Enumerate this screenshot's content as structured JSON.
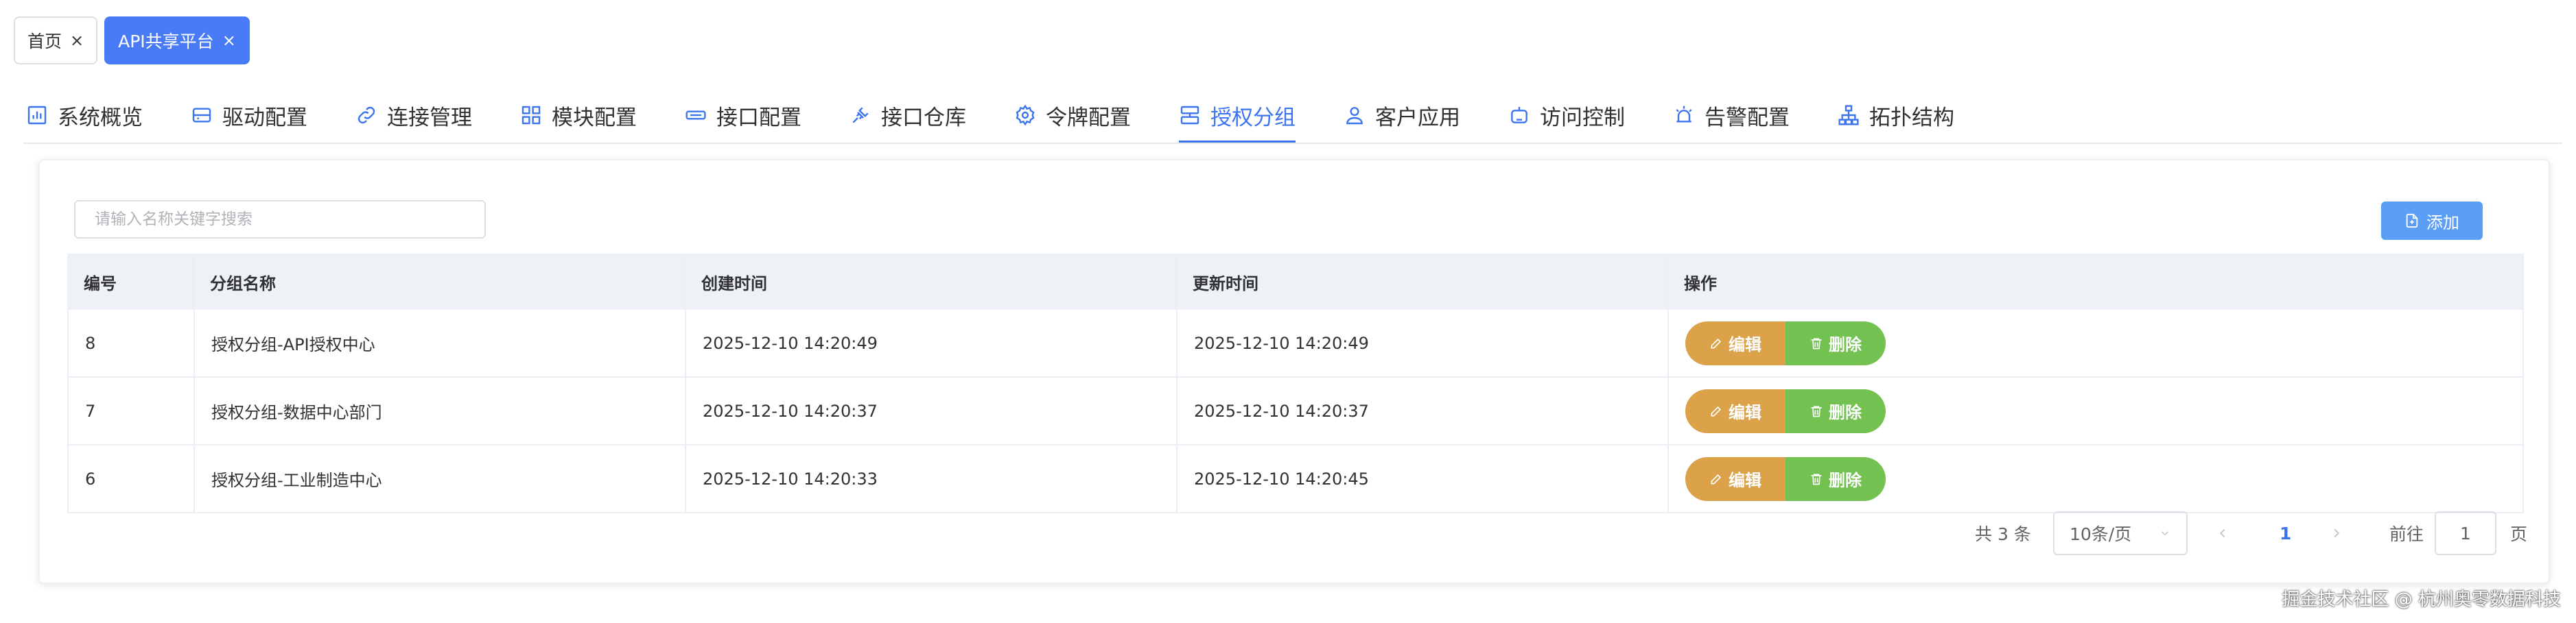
{
  "page_tabs": [
    {
      "label": "首页",
      "close": "×"
    },
    {
      "label": "API共享平台",
      "close": "×"
    }
  ],
  "nav": [
    {
      "label": "系统概览",
      "icon": "chart-icon"
    },
    {
      "label": "驱动配置",
      "icon": "drive-icon"
    },
    {
      "label": "连接管理",
      "icon": "link-icon"
    },
    {
      "label": "模块配置",
      "icon": "grid-icon"
    },
    {
      "label": "接口配置",
      "icon": "ticket-icon"
    },
    {
      "label": "接口仓库",
      "icon": "plug-icon"
    },
    {
      "label": "令牌配置",
      "icon": "gear-icon"
    },
    {
      "label": "授权分组",
      "icon": "server-icon"
    },
    {
      "label": "客户应用",
      "icon": "user-icon"
    },
    {
      "label": "访问控制",
      "icon": "robot-icon"
    },
    {
      "label": "告警配置",
      "icon": "alarm-icon"
    },
    {
      "label": "拓扑结构",
      "icon": "topology-icon"
    }
  ],
  "active_nav": "授权分组",
  "search": {
    "placeholder": "请输入名称关键字搜索"
  },
  "add_button": {
    "label": "添加"
  },
  "table": {
    "headers": [
      "编号",
      "分组名称",
      "创建时间",
      "更新时间",
      "操作"
    ],
    "rows": [
      {
        "id": "8",
        "name": "授权分组-API授权中心",
        "created": "2025-12-10 14:20:49",
        "updated": "2025-12-10 14:20:49"
      },
      {
        "id": "7",
        "name": "授权分组-数据中心部门",
        "created": "2025-12-10 14:20:37",
        "updated": "2025-12-10 14:20:37"
      },
      {
        "id": "6",
        "name": "授权分组-工业制造中心",
        "created": "2025-12-10 14:20:33",
        "updated": "2025-12-10 14:20:45"
      }
    ],
    "edit_label": "编辑",
    "delete_label": "删除"
  },
  "pagination": {
    "total": "共 3 条",
    "page_size": "10条/页",
    "current_page": "1",
    "goto_label": "前往",
    "goto_value": "1",
    "page_suffix": "页"
  },
  "watermark": "掘金技术社区 @ 杭州奥零数据科技",
  "colors": {
    "primary": "#3c74f0",
    "edit_button": "#dba24a",
    "delete_button": "#72c151",
    "add_button": "#5b9ef5"
  }
}
